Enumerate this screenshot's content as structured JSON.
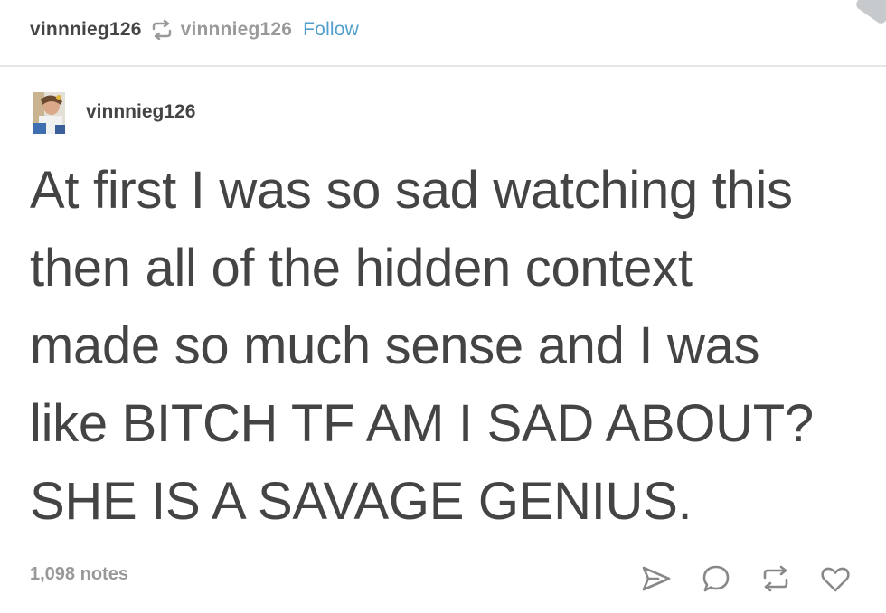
{
  "header": {
    "reblogger": "vinnnieg126",
    "source": "vinnnieg126",
    "follow_label": "Follow",
    "reblog_icon": "reblog-icon"
  },
  "post": {
    "author": "vinnnieg126",
    "avatar_icon": "avatar",
    "lines": [
      "At first I was so sad watching this",
      "then all of the hidden context",
      "made so much sense and I was",
      "like BITCH TF AM I SAD ABOUT?",
      "SHE IS A SAVAGE GENIUS."
    ],
    "notes": "1,098 notes"
  },
  "actions": {
    "icons": [
      "share-icon",
      "comment-icon",
      "reblog-icon",
      "like-icon"
    ]
  },
  "colors": {
    "text": "#444444",
    "muted": "#999999",
    "link": "#529ecc",
    "divider": "#e6e6e6"
  }
}
